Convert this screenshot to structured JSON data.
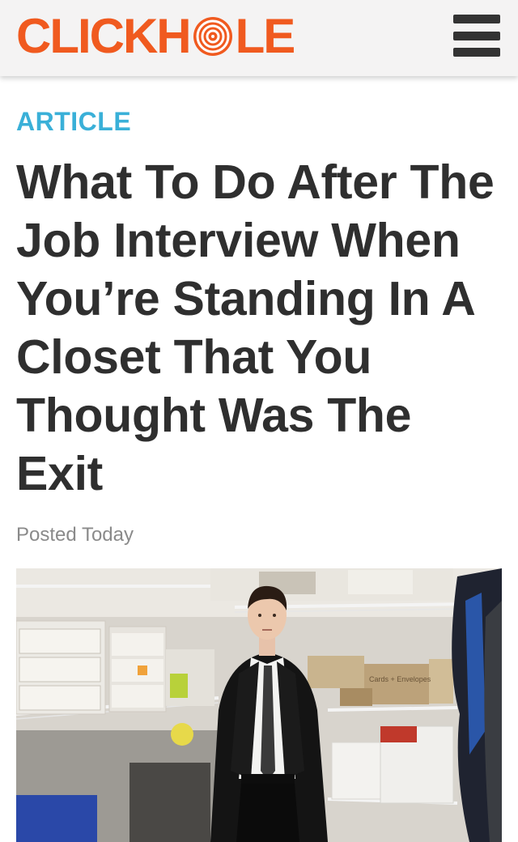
{
  "header": {
    "logo_text_pre": "CLICKH",
    "logo_text_post": "LE",
    "logo_color": "#f05a1f",
    "menu_icon": "hamburger-menu-icon"
  },
  "article": {
    "category": "ARTICLE",
    "category_color": "#3ab0d8",
    "title": "What To Do After The Job Interview When You’re Standing In A Closet That You Thought Was The Exit",
    "posted": "Posted Today"
  },
  "image_labels": {
    "box_label": "Cards + Envelopes"
  }
}
